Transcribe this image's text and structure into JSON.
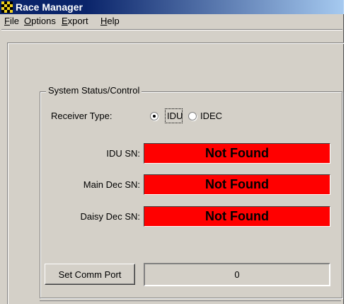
{
  "window": {
    "title": "Race Manager",
    "icon": "checkered-flag-icon"
  },
  "menu": [
    {
      "label": "File",
      "accel": "F",
      "rest": "ile"
    },
    {
      "label": "Options",
      "accel": "O",
      "rest": "ptions"
    },
    {
      "label": "Export",
      "accel": "E",
      "rest": "xport"
    },
    {
      "label": "Help",
      "accel": "H",
      "rest": "elp"
    }
  ],
  "group": {
    "title": "System Status/Control",
    "receiver_type_label": "Receiver Type:",
    "receiver_options": [
      {
        "label": "IDU",
        "selected": true
      },
      {
        "label": "IDEC",
        "selected": false
      }
    ],
    "serials": [
      {
        "label": "IDU SN:",
        "value": "Not Found"
      },
      {
        "label": "Main Dec SN:",
        "value": "Not Found"
      },
      {
        "label": "Daisy Dec SN:",
        "value": "Not Found"
      }
    ],
    "set_comm_port_label": "Set Comm Port",
    "comm_port_value": "0"
  },
  "colors": {
    "status_bg": "#ff0000",
    "titlebar": "#0a246a",
    "face": "#d4d0c8"
  }
}
